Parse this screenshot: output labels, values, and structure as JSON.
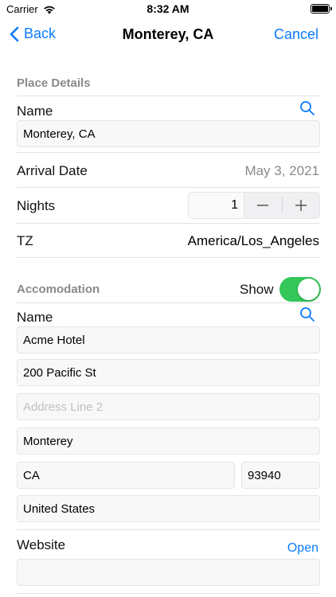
{
  "status_bar": {
    "carrier": "Carrier",
    "time": "8:32 AM"
  },
  "nav": {
    "back_label": "Back",
    "title": "Monterey, CA",
    "cancel_label": "Cancel"
  },
  "place": {
    "section_title": "Place Details",
    "name_label": "Name",
    "name_value": "Monterey, CA",
    "arrival_label": "Arrival Date",
    "arrival_value": "May 3, 2021",
    "nights_label": "Nights",
    "nights_value": "1",
    "tz_label": "TZ",
    "tz_value": "America/Los_Angeles"
  },
  "accommodation": {
    "section_title": "Accomodation",
    "show_label": "Show",
    "show_on": true,
    "name_label": "Name",
    "name_value": "Acme Hotel",
    "address1": "200 Pacific St",
    "address2_placeholder": "Address Line 2",
    "city": "Monterey",
    "state": "CA",
    "zip": "93940",
    "country": "United States",
    "website_label": "Website",
    "open_label": "Open",
    "website_value": ""
  },
  "icons": {
    "back": "chevron-left-icon",
    "search": "search-icon",
    "signal": "wifi-icon",
    "battery": "battery-icon"
  },
  "colors": {
    "accent": "#0a7aff",
    "toggle_on": "#34c759",
    "secondary_text": "#8a8a8e"
  }
}
